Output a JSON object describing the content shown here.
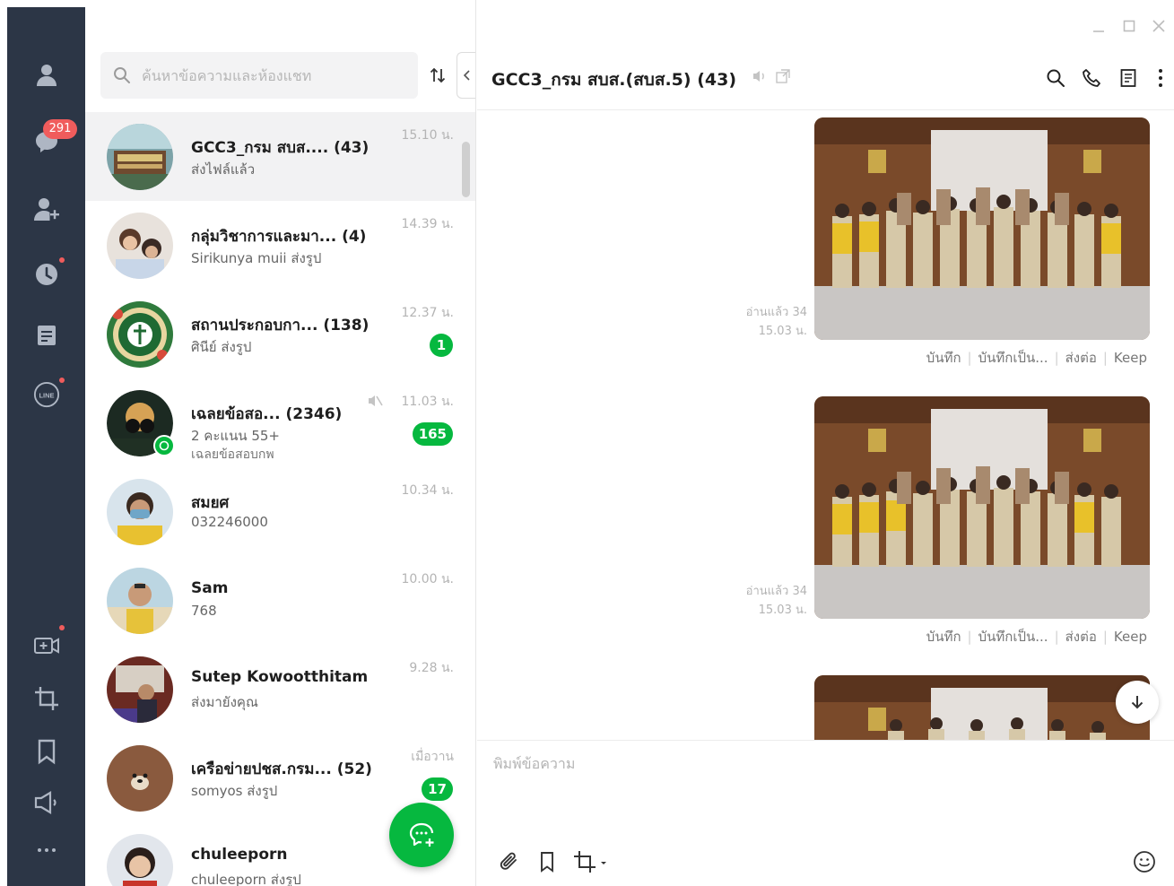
{
  "search": {
    "placeholder": "ค้นหาข้อความและห้องแชท"
  },
  "rail": {
    "badge": "291"
  },
  "chats": [
    {
      "name": "GCC3_กรม สบส.... (43)",
      "sub": "ส่งไฟล์แล้ว",
      "time": "15.10 น."
    },
    {
      "name": "กลุ่มวิชาการและมา... (4)",
      "sub": "Sirikunya muii ส่งรูป",
      "time": "14.39 น."
    },
    {
      "name": "สถานประกอบกา... (138)",
      "sub": "ศินีย์ ส่งรูป",
      "time": "12.37 น.",
      "unread": "1"
    },
    {
      "name": "เฉลยข้อสอ... (2346)",
      "sub": "2 คะแนน  55+",
      "sub2": "เฉลยข้อสอบกพ",
      "time": "11.03 น.",
      "unread": "165"
    },
    {
      "name": "สมยศ",
      "sub": "032246000",
      "time": "10.34 น."
    },
    {
      "name": "Sam",
      "sub": "768",
      "time": "10.00 น."
    },
    {
      "name": "Sutep Kowootthitam",
      "sub": "ส่งมายังคุณ",
      "time": "9.28 น."
    },
    {
      "name": "เครือข่ายปชส.กรม...  (52)",
      "sub": "somyos ส่งรูป",
      "time": "เมื่อวาน",
      "unread": "17"
    },
    {
      "name": "chuleeporn",
      "sub": "chuleeporn ส่งรูป",
      "time": ""
    }
  ],
  "conversation": {
    "title": "GCC3_กรม สบส.(สบส.5) (43)",
    "messages": [
      {
        "read": "อ่านแล้ว 34",
        "time": "15.03 น.",
        "actions": [
          "บันทึก",
          "บันทึกเป็น...",
          "ส่งต่อ",
          "Keep"
        ]
      },
      {
        "read": "อ่านแล้ว 34",
        "time": "15.03 น.",
        "actions": [
          "บันทึก",
          "บันทึกเป็น...",
          "ส่งต่อ",
          "Keep"
        ]
      }
    ],
    "input_placeholder": "พิมพ์ข้อความ"
  },
  "colors": {
    "rail": "#2c3646",
    "accent": "#06b83f",
    "badge": "#f05c5c"
  },
  "icons": [
    "friends-icon",
    "chats-icon",
    "add-friend-icon",
    "timeline-icon",
    "notes-icon",
    "line-icon",
    "video-call-icon",
    "crop-icon",
    "bookmark-icon",
    "announcement-icon",
    "more-icon"
  ]
}
